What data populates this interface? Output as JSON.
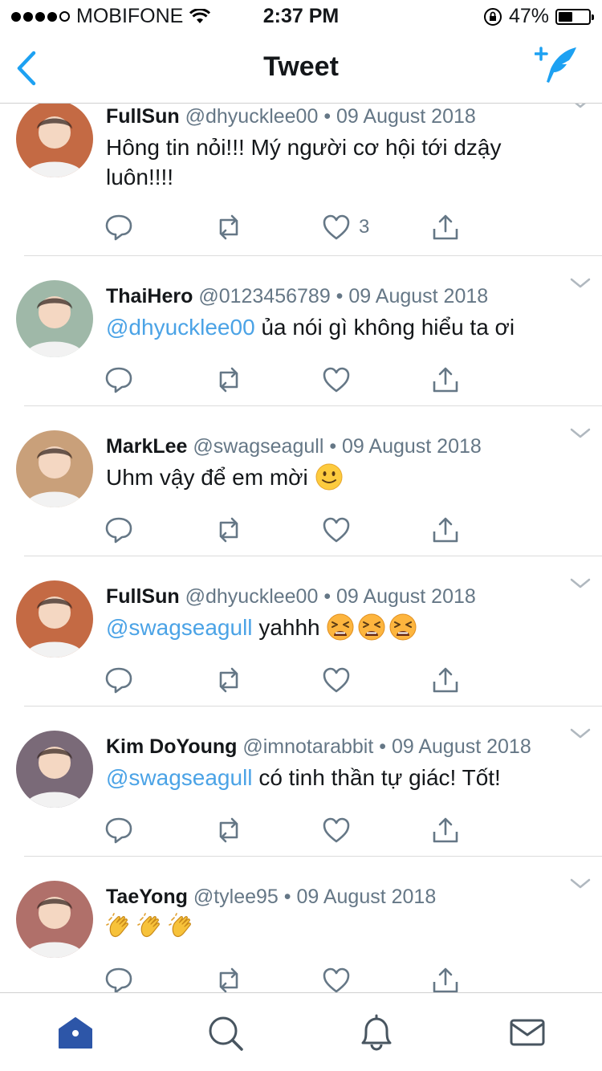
{
  "status_bar": {
    "carrier": "MOBIFONE",
    "time": "2:37 PM",
    "battery": "47%",
    "battery_level": 0.47,
    "signal_bars": 4
  },
  "header": {
    "title": "Tweet",
    "back_icon": "chevron-left-icon",
    "compose_icon": "compose-tweet-icon"
  },
  "colors": {
    "accent": "#1DA1F2",
    "link": "#4BA3E6",
    "text": "#14171A",
    "secondary": "#657786",
    "tab_active": "#2D56A8",
    "tab_inactive": "#485560"
  },
  "tweets": [
    {
      "name": "FullSun",
      "handle": "@dhyucklee00",
      "date": "09 August 2018",
      "mention": "",
      "text": "Hông tin nỏi!!! Mý người cơ hội tới dzậy luôn!!!!",
      "emojis": [],
      "like_count": "3",
      "avatar_bg": "#c46a44"
    },
    {
      "name": "ThaiHero",
      "handle": "@0123456789",
      "date": "09 August 2018",
      "mention": "@dhyucklee00",
      "text": "ủa nói gì không hiểu ta ơi",
      "emojis": [],
      "like_count": "",
      "avatar_bg": "#9fb8a8"
    },
    {
      "name": "MarkLee",
      "handle": "@swagseagull",
      "date": "09 August 2018",
      "mention": "",
      "text": "Uhm vậy để em mời",
      "emojis": [
        "slightly-smiling-face"
      ],
      "like_count": "",
      "avatar_bg": "#c9a07a"
    },
    {
      "name": "FullSun",
      "handle": "@dhyucklee00",
      "date": "09 August 2018",
      "mention": "@swagseagull",
      "text": "yahhh",
      "emojis": [
        "tired-face",
        "tired-face",
        "tired-face"
      ],
      "like_count": "",
      "avatar_bg": "#c46a44"
    },
    {
      "name": "Kim DoYoung",
      "handle": "@imnotarabbit",
      "date": "09 August 2018",
      "mention": "@swagseagull",
      "text": "có tinh thần tự giác! Tốt!",
      "emojis": [],
      "like_count": "",
      "avatar_bg": "#7a6a78"
    },
    {
      "name": "TaeYong",
      "handle": "@tylee95",
      "date": "09 August 2018",
      "mention": "",
      "text": "",
      "emojis": [
        "clapping-hands",
        "clapping-hands",
        "clapping-hands"
      ],
      "like_count": "",
      "avatar_bg": "#b0706a"
    }
  ],
  "tab_bar": {
    "items": [
      {
        "id": "home",
        "icon": "home-icon",
        "active": true
      },
      {
        "id": "search",
        "icon": "search-icon",
        "active": false
      },
      {
        "id": "notifications",
        "icon": "bell-icon",
        "active": false
      },
      {
        "id": "messages",
        "icon": "envelope-icon",
        "active": false
      }
    ]
  }
}
